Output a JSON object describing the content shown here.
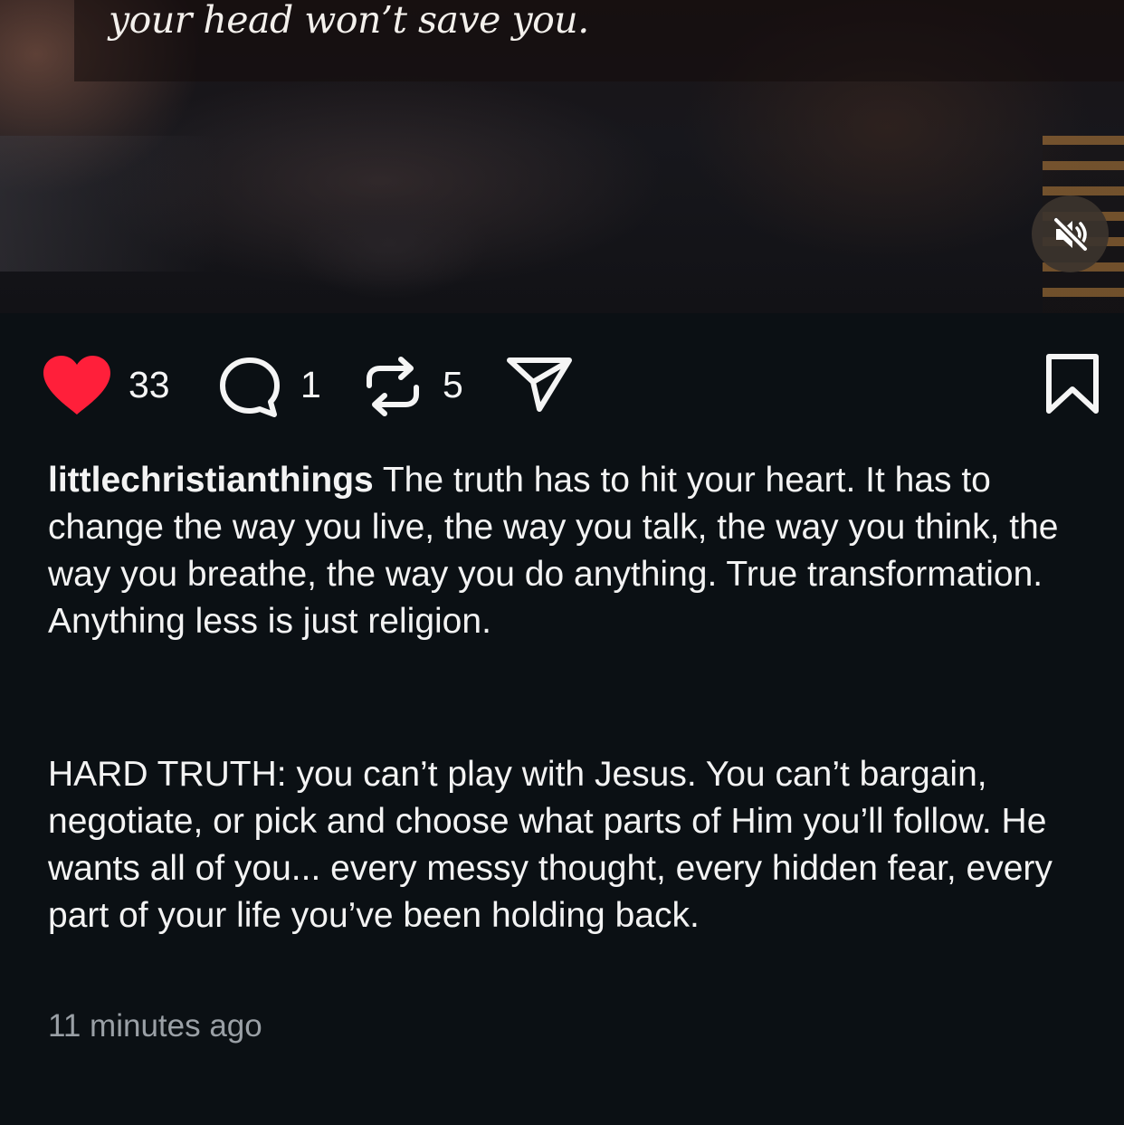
{
  "video": {
    "overlay_text": "your head won’t save you.",
    "muted": true
  },
  "actions": {
    "like_count": "33",
    "comment_count": "1",
    "repost_count": "5",
    "liked": true,
    "like_color": "#ff1f3a"
  },
  "post": {
    "username": "littlechristianthings",
    "caption_paragraph_1": " The truth has to hit your heart. It has to change the way you live, the way you talk, the way you think, the way you breathe, the way you do anything. True transformation. Anything less is just religion.",
    "caption_paragraph_2": "HARD TRUTH: you can’t play with Jesus. You can’t bargain, negotiate, or pick and choose what parts of Him you’ll follow. He wants all of you... every messy thought, every hidden fear, every part of your life you’ve been holding back.",
    "timestamp": "11 minutes ago"
  },
  "icons": {
    "like": "heart-icon",
    "comment": "comment-bubble-icon",
    "repost": "repost-icon",
    "share": "paper-plane-icon",
    "save": "bookmark-icon",
    "mute": "speaker-muted-icon"
  }
}
